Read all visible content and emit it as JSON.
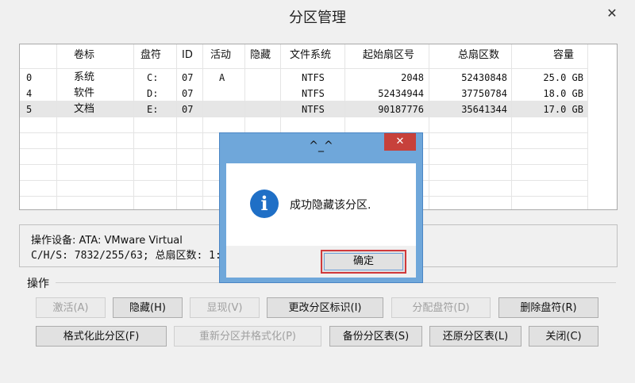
{
  "window": {
    "title": "分区管理",
    "close_glyph": "✕"
  },
  "table": {
    "headers": [
      "卷标",
      "盘符",
      "ID",
      "活动",
      "隐藏",
      "文件系统",
      "起始扇区号",
      "总扇区数",
      "容量"
    ],
    "rows": [
      {
        "idx": "0",
        "label": "系统",
        "drive": "C:",
        "id": "07",
        "active": "A",
        "hidden": "",
        "fs": "NTFS",
        "start": "2048",
        "total": "52430848",
        "size": "25.0 GB"
      },
      {
        "idx": "4",
        "label": "软件",
        "drive": "D:",
        "id": "07",
        "active": "",
        "hidden": "",
        "fs": "NTFS",
        "start": "52434944",
        "total": "37750784",
        "size": "18.0 GB"
      },
      {
        "idx": "5",
        "label": "文档",
        "drive": "E:",
        "id": "07",
        "active": "",
        "hidden": "",
        "fs": "NTFS",
        "start": "90187776",
        "total": "35641344",
        "size": "17.0 GB"
      }
    ]
  },
  "device_info": {
    "line1": "操作设备:   ATA: VMware Virtual",
    "line2": "C/H/S: 7832/255/63; 总扇区数: 1:"
  },
  "operations": {
    "label": "操作",
    "buttons": {
      "activate": "激活(A)",
      "hide": "隐藏(H)",
      "show": "显现(V)",
      "change_id": "更改分区标识(I)",
      "assign_drive": "分配盘符(D)",
      "delete_drive": "删除盘符(R)",
      "format": "格式化此分区(F)",
      "repartition_format": "重新分区并格式化(P)",
      "backup_table": "备份分区表(S)",
      "restore_table": "还原分区表(L)",
      "close": "关闭(C)"
    }
  },
  "message_box": {
    "title": "^_^",
    "close_glyph": "✕",
    "icon_glyph": "i",
    "text": "成功隐藏该分区.",
    "ok": "确定"
  },
  "colors": {
    "dialog_border": "#6fa7da",
    "close_red": "#c7413b",
    "info_blue": "#1f6fc6",
    "focus_red": "#d0393b"
  }
}
